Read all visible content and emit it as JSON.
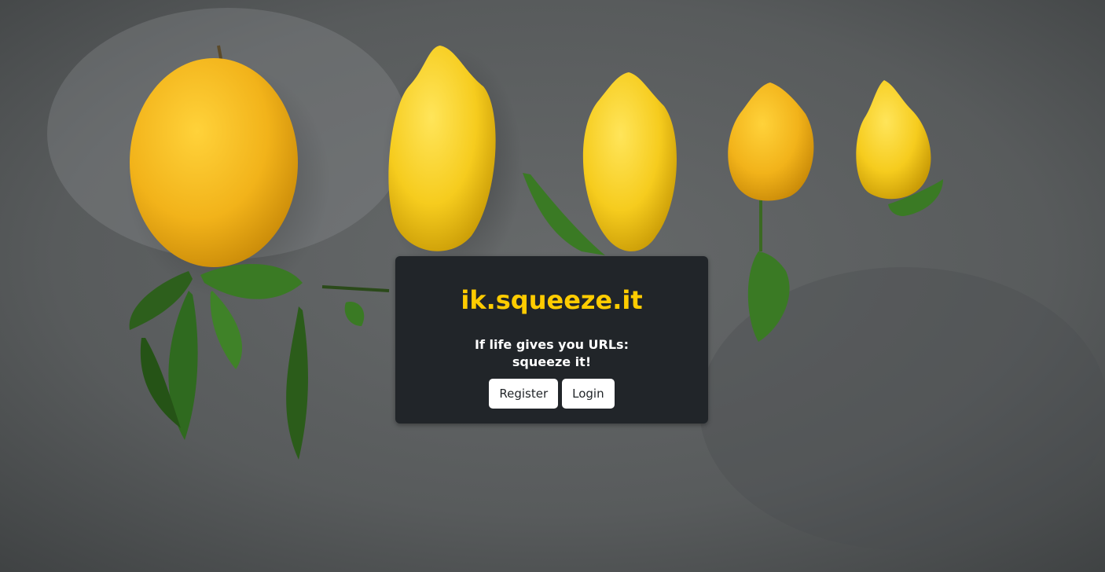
{
  "brand": {
    "title": "ik.squeeze.it",
    "title_color": "#ffcc00"
  },
  "tagline": {
    "line1": "If life gives you URLs:",
    "line2": "squeeze it!"
  },
  "actions": {
    "register_label": "Register",
    "login_label": "Login"
  },
  "background": {
    "description_icon": "lemons-on-concrete-photo",
    "base_color": "#56595a",
    "card_color": "#212529",
    "lemon_color": "#f2bd16",
    "leaf_color": "#2f6a1f"
  }
}
